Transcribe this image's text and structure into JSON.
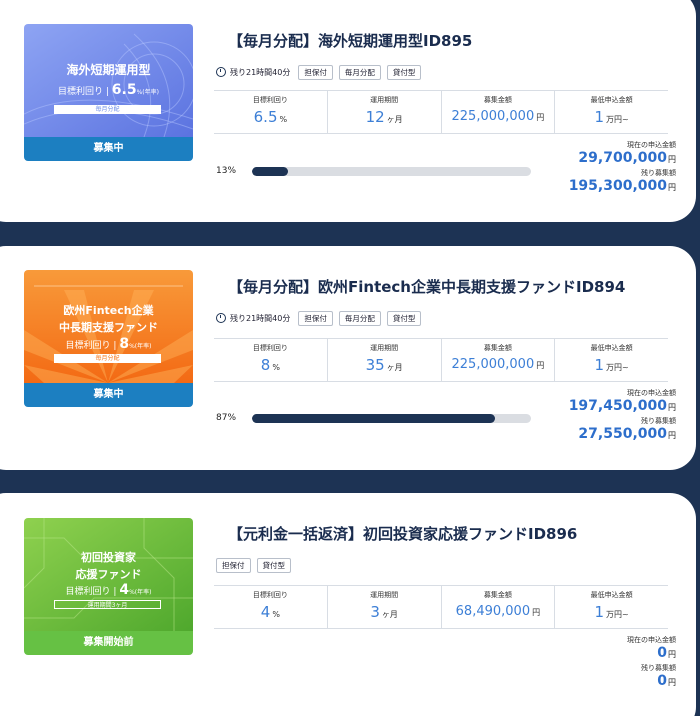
{
  "funds": [
    {
      "title": "【毎月分配】海外短期運用型ID895",
      "status": "募集中",
      "status_color": "#1c7fc1",
      "thumb": {
        "name_line1": "海外短期運用型",
        "name_line2": "",
        "yield_label": "目標利回り",
        "yield_value": "6.5",
        "yield_suffix": "%(年率)",
        "tag_text": "毎月分配",
        "theme_color": "#6f8fe8"
      },
      "timer": "残り21時間40分",
      "tags": [
        "担保付",
        "毎月分配",
        "貸付型"
      ],
      "stats": {
        "yield_label": "目標利回り",
        "yield_value": "6.5",
        "yield_unit": "%",
        "period_label": "運用期間",
        "period_value": "12",
        "period_unit": "ヶ月",
        "amount_label": "募集金額",
        "amount_value": "225,000,000",
        "amount_unit": "円",
        "min_label": "最低申込金額",
        "min_value": "1",
        "min_unit": "万円~"
      },
      "progress_percent": 13,
      "progress_label": "13%",
      "current_label": "現在の申込金額",
      "current_value": "29,700,000",
      "current_unit": "円",
      "remaining_label": "残り募集額",
      "remaining_value": "195,300,000",
      "remaining_unit": "円"
    },
    {
      "title": "【毎月分配】欧州Fintech企業中長期支援ファンドID894",
      "status": "募集中",
      "status_color": "#1c7fc1",
      "thumb": {
        "name_line1": "欧州Fintech企業",
        "name_line2": "中長期支援ファンド",
        "yield_label": "目標利回り",
        "yield_value": "8",
        "yield_suffix": "%(年率)",
        "tag_text": "毎月分配",
        "theme_color": "#f47a1f"
      },
      "timer": "残り21時間40分",
      "tags": [
        "担保付",
        "毎月分配",
        "貸付型"
      ],
      "stats": {
        "yield_label": "目標利回り",
        "yield_value": "8",
        "yield_unit": "%",
        "period_label": "運用期間",
        "period_value": "35",
        "period_unit": "ヶ月",
        "amount_label": "募集金額",
        "amount_value": "225,000,000",
        "amount_unit": "円",
        "min_label": "最低申込金額",
        "min_value": "1",
        "min_unit": "万円~"
      },
      "progress_percent": 87,
      "progress_label": "87%",
      "current_label": "現在の申込金額",
      "current_value": "197,450,000",
      "current_unit": "円",
      "remaining_label": "残り募集額",
      "remaining_value": "27,550,000",
      "remaining_unit": "円"
    },
    {
      "title": "【元利金一括返済】初回投資家応援ファンドID896",
      "status": "募集開始前",
      "status_color": "#66c144",
      "thumb": {
        "name_line1": "初回投資家",
        "name_line2": "応援ファンド",
        "yield_label": "目標利回り",
        "yield_value": "4",
        "yield_suffix": "%(年率)",
        "tag_text": "運用期間3ヶ月",
        "theme_color": "#6cbc3b"
      },
      "timer": "",
      "tags": [
        "担保付",
        "貸付型"
      ],
      "stats": {
        "yield_label": "目標利回り",
        "yield_value": "4",
        "yield_unit": "%",
        "period_label": "運用期間",
        "period_value": "3",
        "period_unit": "ヶ月",
        "amount_label": "募集金額",
        "amount_value": "68,490,000",
        "amount_unit": "円",
        "min_label": "最低申込金額",
        "min_value": "1",
        "min_unit": "万円~"
      },
      "current_label": "現在の申込金額",
      "current_value": "0",
      "current_unit": "円",
      "remaining_label": "残り募集額",
      "remaining_value": "0",
      "remaining_unit": "円"
    }
  ]
}
